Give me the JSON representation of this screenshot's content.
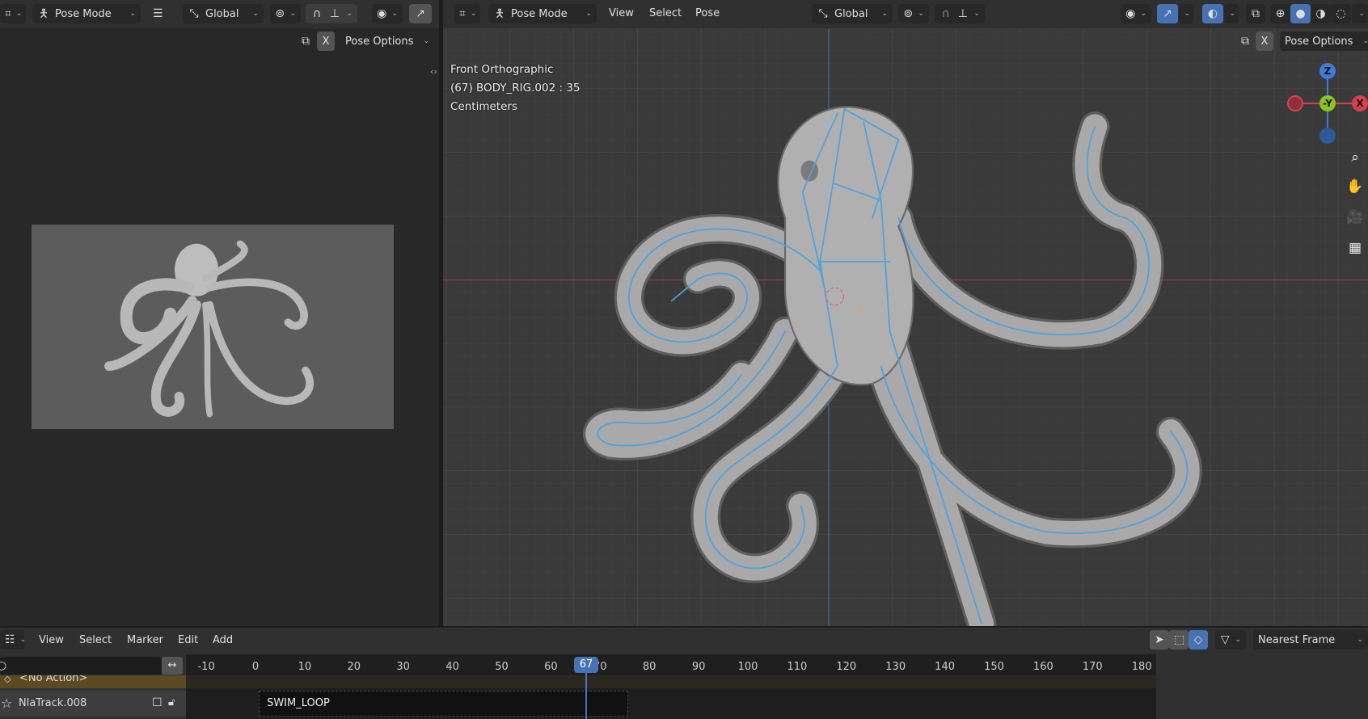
{
  "left_editor": {
    "mode": "Pose Mode",
    "orientation": "Global",
    "pose_options": "Pose Options",
    "x_mirror": "X",
    "icons": [
      "editor-type-icon",
      "pose-mode-icon",
      "hamburger-icon",
      "transform-orientation-icon",
      "pivot-icon",
      "snap-icon",
      "snap-increment-icon",
      "visibility-icon",
      "gizmo-icon",
      "mirror-icon"
    ]
  },
  "viewport": {
    "header": {
      "mode": "Pose Mode",
      "menus": [
        "View",
        "Select",
        "Pose"
      ],
      "orientation": "Global",
      "pose_options": "Pose Options",
      "x_mirror": "X"
    },
    "overlay": {
      "view_name": "Front Orthographic",
      "object_info": "(67) BODY_RIG.002 : 35",
      "units": "Centimeters"
    },
    "gizmo": {
      "z": "Z",
      "y": "-Y",
      "x": "X"
    },
    "colors": {
      "x_axis": "#d9404f",
      "y_axis": "#8bc41f",
      "z_axis": "#3b7dd8",
      "bone": "#4aa3df",
      "accent": "#4772b3"
    }
  },
  "timeline": {
    "menus": [
      "View",
      "Select",
      "Marker",
      "Edit",
      "Add"
    ],
    "snap_mode": "Nearest Frame",
    "current_frame": "67",
    "ruler": [
      "-10",
      "0",
      "10",
      "20",
      "30",
      "40",
      "50",
      "60",
      "70",
      "80",
      "90",
      "100",
      "110",
      "120",
      "130",
      "140",
      "150",
      "160",
      "170",
      "180"
    ],
    "tracks": [
      {
        "name": "<No Action>"
      },
      {
        "name": "NlaTrack.008",
        "strip": "SWIM_LOOP",
        "strip_start": 1,
        "strip_end": 75
      }
    ]
  }
}
